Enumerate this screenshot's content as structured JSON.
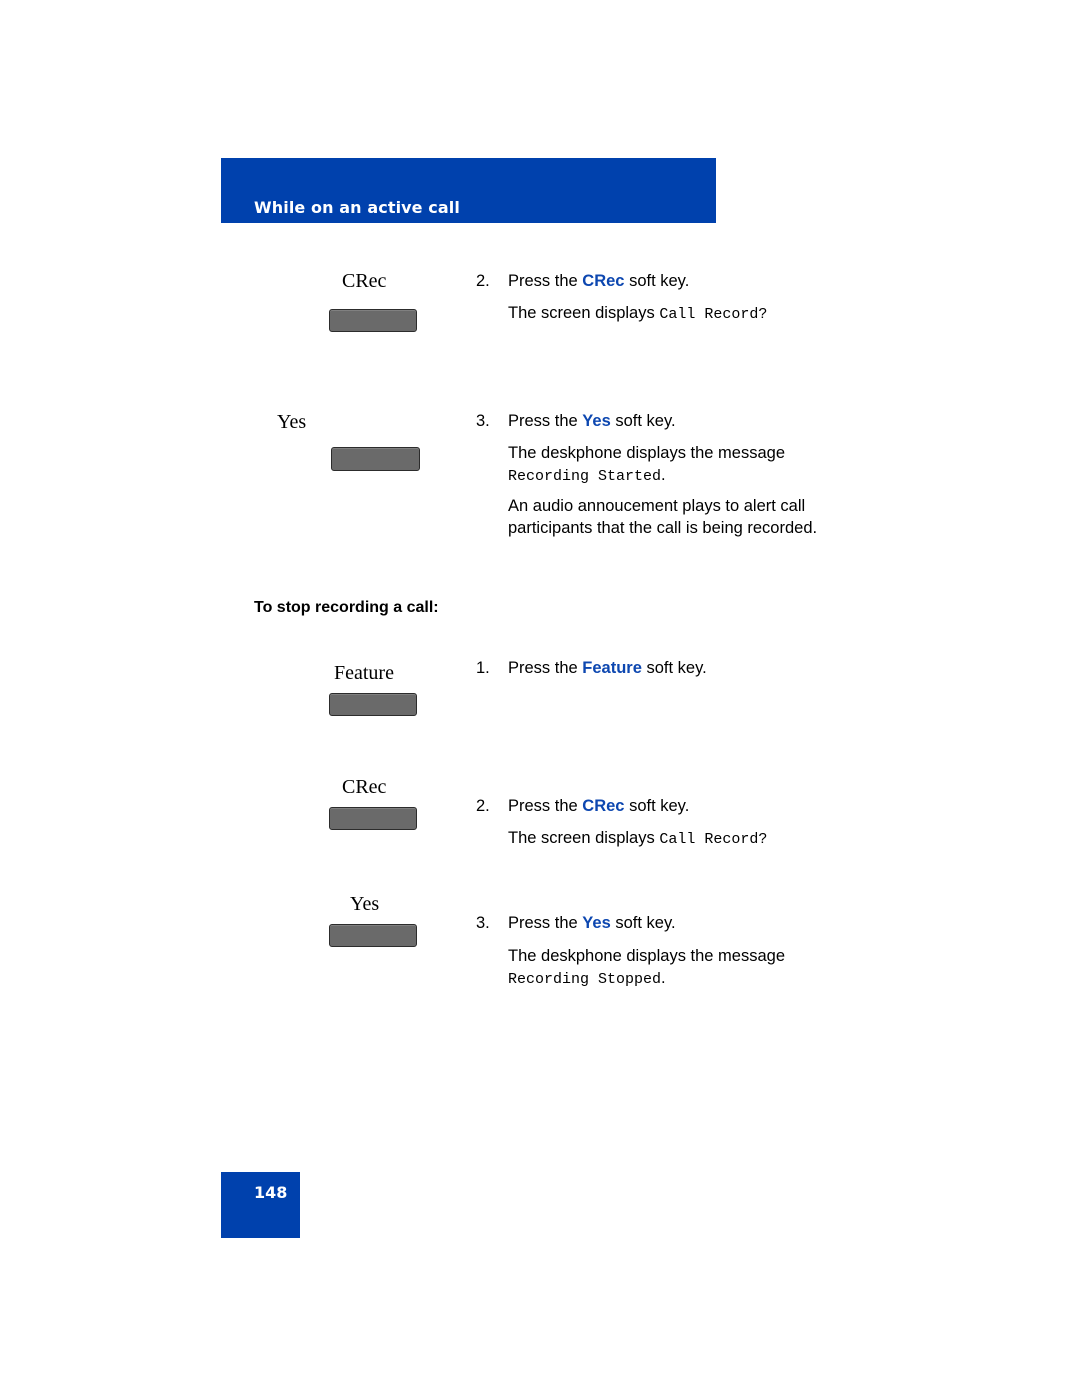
{
  "header": {
    "title": "While on an active call",
    "color": "#0041ad"
  },
  "start_section": {
    "steps": [
      {
        "key_label": "CRec",
        "num": "2.",
        "pre": "Press the ",
        "keyword": "CRec",
        "post": " soft key.",
        "detail_pre": "The screen displays ",
        "detail_mono": "Call Record?"
      },
      {
        "key_label": "Yes",
        "num": "3.",
        "pre": "Press the ",
        "keyword": "Yes",
        "post": " soft key.",
        "detail_pre": "The deskphone displays the message",
        "detail_mono": "Recording Started",
        "detail_end": ".",
        "extra": "An audio annoucement plays to alert call participants that the call is being recorded."
      }
    ]
  },
  "stop_section": {
    "heading": "To stop recording a call:",
    "steps": [
      {
        "key_label": "Feature",
        "num": "1.",
        "pre": "Press the ",
        "keyword": "Feature",
        "post": " soft key."
      },
      {
        "key_label": "CRec",
        "num": "2.",
        "pre": "Press the ",
        "keyword": "CRec",
        "post": " soft key.",
        "detail_pre": "The screen displays ",
        "detail_mono": "Call Record?"
      },
      {
        "key_label": "Yes",
        "num": "3.",
        "pre": "Press the ",
        "keyword": "Yes",
        "post": " soft key.",
        "detail_pre": "The deskphone displays the message",
        "detail_mono": "Recording Stopped",
        "detail_end": "."
      }
    ]
  },
  "footer": {
    "page_number": "148"
  }
}
